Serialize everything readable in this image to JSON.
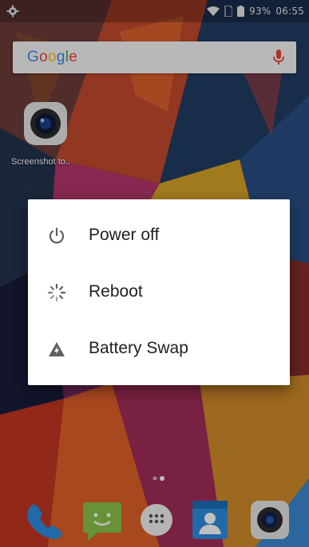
{
  "status_bar": {
    "battery_percent": "93%",
    "time": "06:55",
    "icons": [
      "settings-gear-icon",
      "wifi-icon",
      "sim-icon",
      "battery-icon"
    ]
  },
  "search_bar": {
    "logo_text": "Google",
    "logo_colors": [
      "#4285F4",
      "#EA4335",
      "#FBBC05",
      "#4285F4",
      "#34A853",
      "#EA4335"
    ],
    "mic_icon": "mic-icon",
    "mic_color": "#EA4335"
  },
  "desktop": {
    "shortcut_label": "Screenshot to..",
    "shortcut_icon": "camera-app-icon"
  },
  "power_menu": {
    "items": [
      {
        "label": "Power off",
        "icon": "power-icon"
      },
      {
        "label": "Reboot",
        "icon": "reboot-spinner-icon"
      },
      {
        "label": "Battery Swap",
        "icon": "battery-swap-warning-icon"
      }
    ]
  },
  "dock": {
    "items": [
      "phone-icon",
      "messaging-icon",
      "app-drawer-icon",
      "contacts-icon",
      "camera-icon"
    ]
  },
  "colors": {
    "dialog_bg": "#FFFFFF",
    "dialog_text": "#212121",
    "icon_gray": "#5f5f5f"
  }
}
